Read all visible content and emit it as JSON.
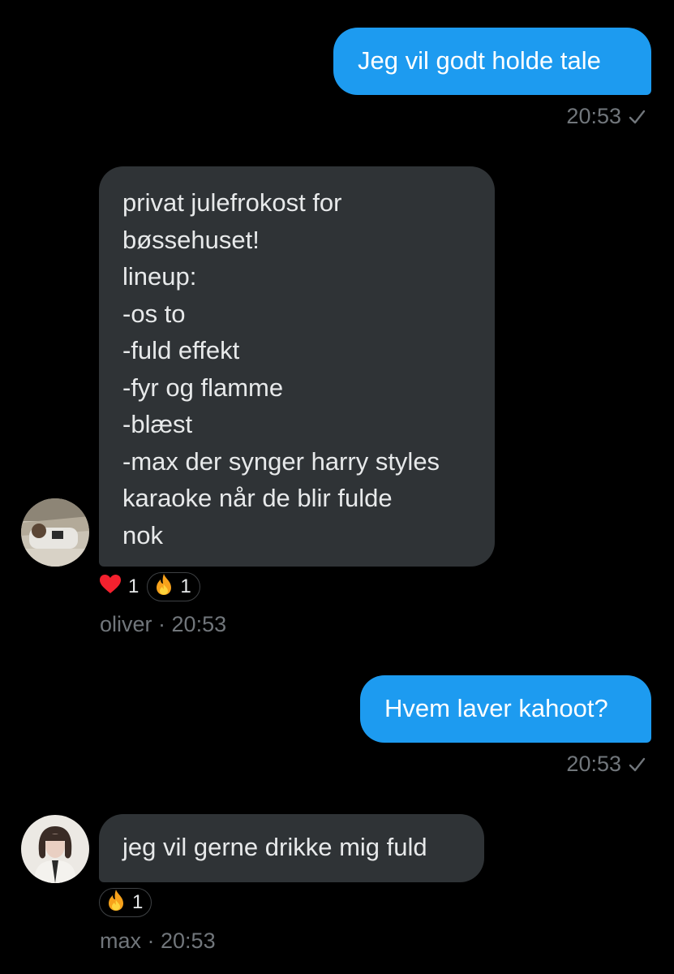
{
  "colors": {
    "background": "#000000",
    "outgoing_bubble": "#1d9bf0",
    "incoming_bubble": "#2f3336",
    "meta_text": "#71767b",
    "heart": "#f4212e",
    "fire": "#f7a21b"
  },
  "messages": [
    {
      "direction": "outgoing",
      "text": "Jeg vil godt holde tale",
      "time": "20:53",
      "status_icon": "check-icon"
    },
    {
      "direction": "incoming",
      "lines": [
        "privat julefrokost for",
        "bøssehuset!",
        "lineup:",
        "-os to",
        "-fuld effekt",
        "-fyr og flamme",
        "-blæst",
        "-max der synger harry styles",
        "karaoke når de blir fulde",
        "nok"
      ],
      "reactions": [
        {
          "icon": "heart-icon",
          "count": "1"
        },
        {
          "icon": "fire-icon",
          "count": "1"
        }
      ],
      "sender": "oliver",
      "separator": " · ",
      "time": "20:53"
    },
    {
      "direction": "outgoing",
      "text": "Hvem laver kahoot?",
      "time": "20:53",
      "status_icon": "check-icon"
    },
    {
      "direction": "incoming",
      "text": "jeg vil gerne drikke mig fuld",
      "reactions": [
        {
          "icon": "fire-icon",
          "count": "1"
        }
      ],
      "sender": "max",
      "separator": " · ",
      "time": "20:53"
    }
  ]
}
